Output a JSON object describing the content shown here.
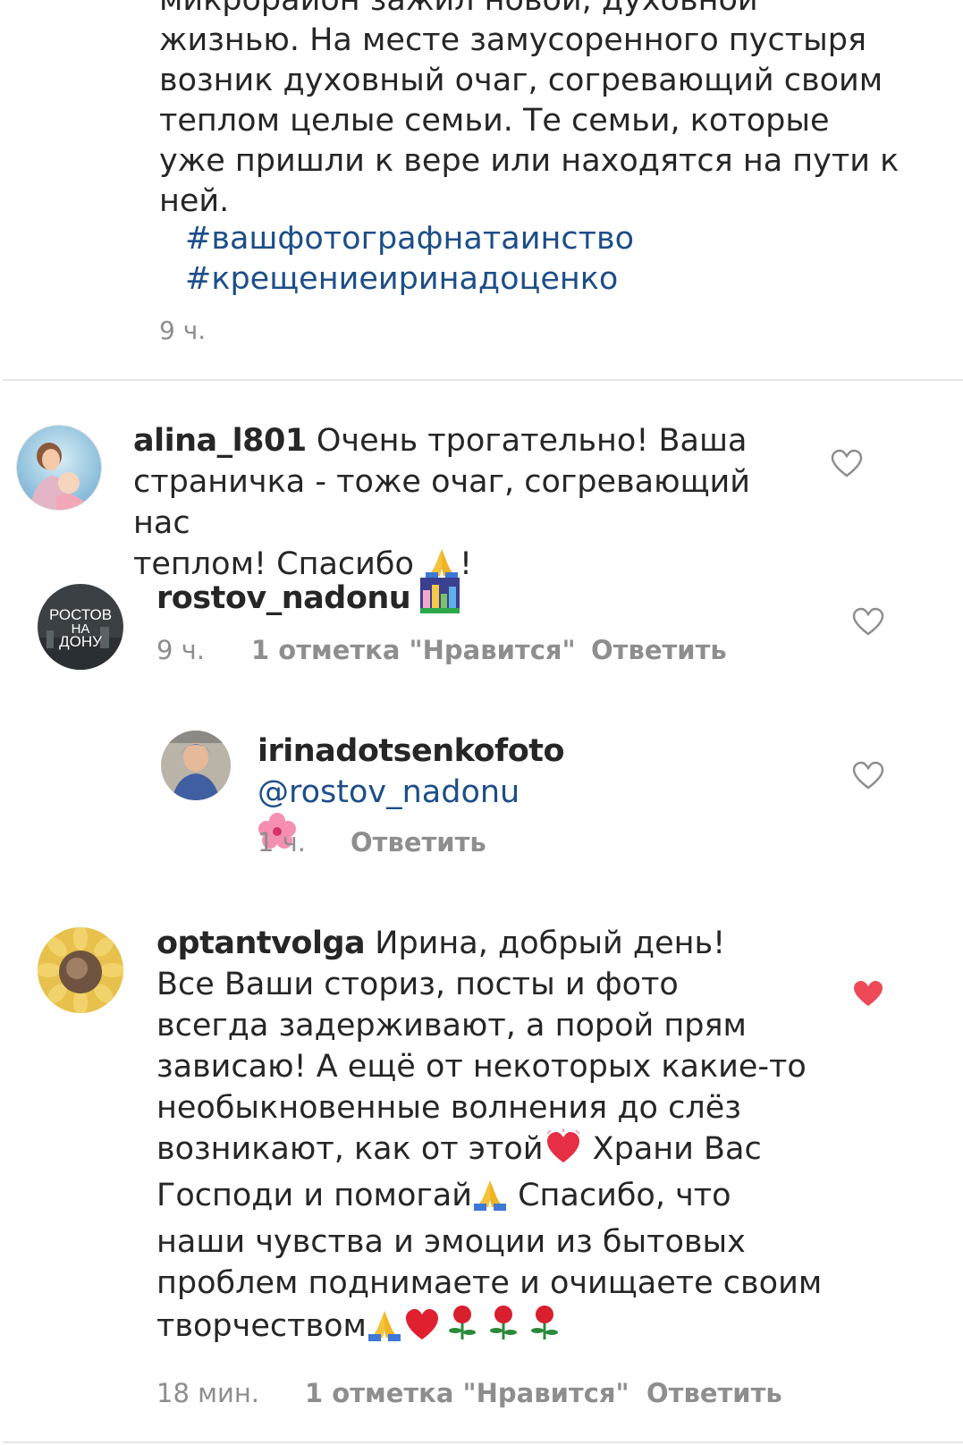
{
  "post": {
    "caption_line0": "микрорайон зажил новой, духовной",
    "caption_lines": "жизнью. На месте замусоренного пустыря\nвозник духовный очаг, согревающий своим\nтеплом целые семьи. Те семьи, которые\nуже пришли к вере или находятся на пути к\nней.",
    "hashtags": [
      "#вашфотографнатаинство",
      "#крещениеиринадоценко"
    ],
    "time": "9 ч."
  },
  "comments": [
    {
      "username": "alina_l801",
      "text_line1": "Очень трогательно! Ваша",
      "text_line2": "страничка - тоже очаг, согревающий нас",
      "text_line3a": "теплом! Спасибо ",
      "text_line3b": "!",
      "liked": false
    },
    {
      "username": "rostov_nadonu",
      "avatar_text": [
        "РОСТОВ",
        "НА",
        "ДОНУ"
      ],
      "time": "9 ч.",
      "likes": "1 отметка \"Нравится\"",
      "reply": "Ответить",
      "liked": false
    },
    {
      "username": "irinadotsenkofoto",
      "mention": "@rostov_nadonu",
      "time": "1 ч.",
      "reply": "Ответить",
      "liked": false
    },
    {
      "username": "optantvolga",
      "first": "Ирина, добрый день!",
      "lines": [
        "Все Ваши сториз, посты и фото",
        "всегда задерживают, а порой прям",
        "зависаю! А ещё от некоторых какие-то",
        "необыкновенные волнения до слёз"
      ],
      "line5a": "возникают, как от этой",
      "line5b": " Храни Вас",
      "line6a": "Господи и помогай",
      "line6b": " Спасибо, что",
      "line7": "наши чувства и эмоции из бытовых",
      "line8": "проблем поднимаете и очищаете своим",
      "line9": "творчеством",
      "time": "18 мин.",
      "likes": "1 отметка \"Нравится\"",
      "reply": "Ответить",
      "liked": true,
      "liked_color": "#ed4956"
    }
  ],
  "colors": {
    "text": "#262626",
    "meta": "#8e8e8e",
    "link": "#1d4e89",
    "heart_liked": "#ed4956",
    "heart_outline": "#8e8e8e"
  },
  "icons": [
    "heart-outline-icon",
    "heart-filled-icon",
    "praying-hands-emoji",
    "cityscape-emoji",
    "hibiscus-emoji",
    "sparkling-heart-emoji",
    "red-heart-emoji",
    "rose-emoji"
  ]
}
